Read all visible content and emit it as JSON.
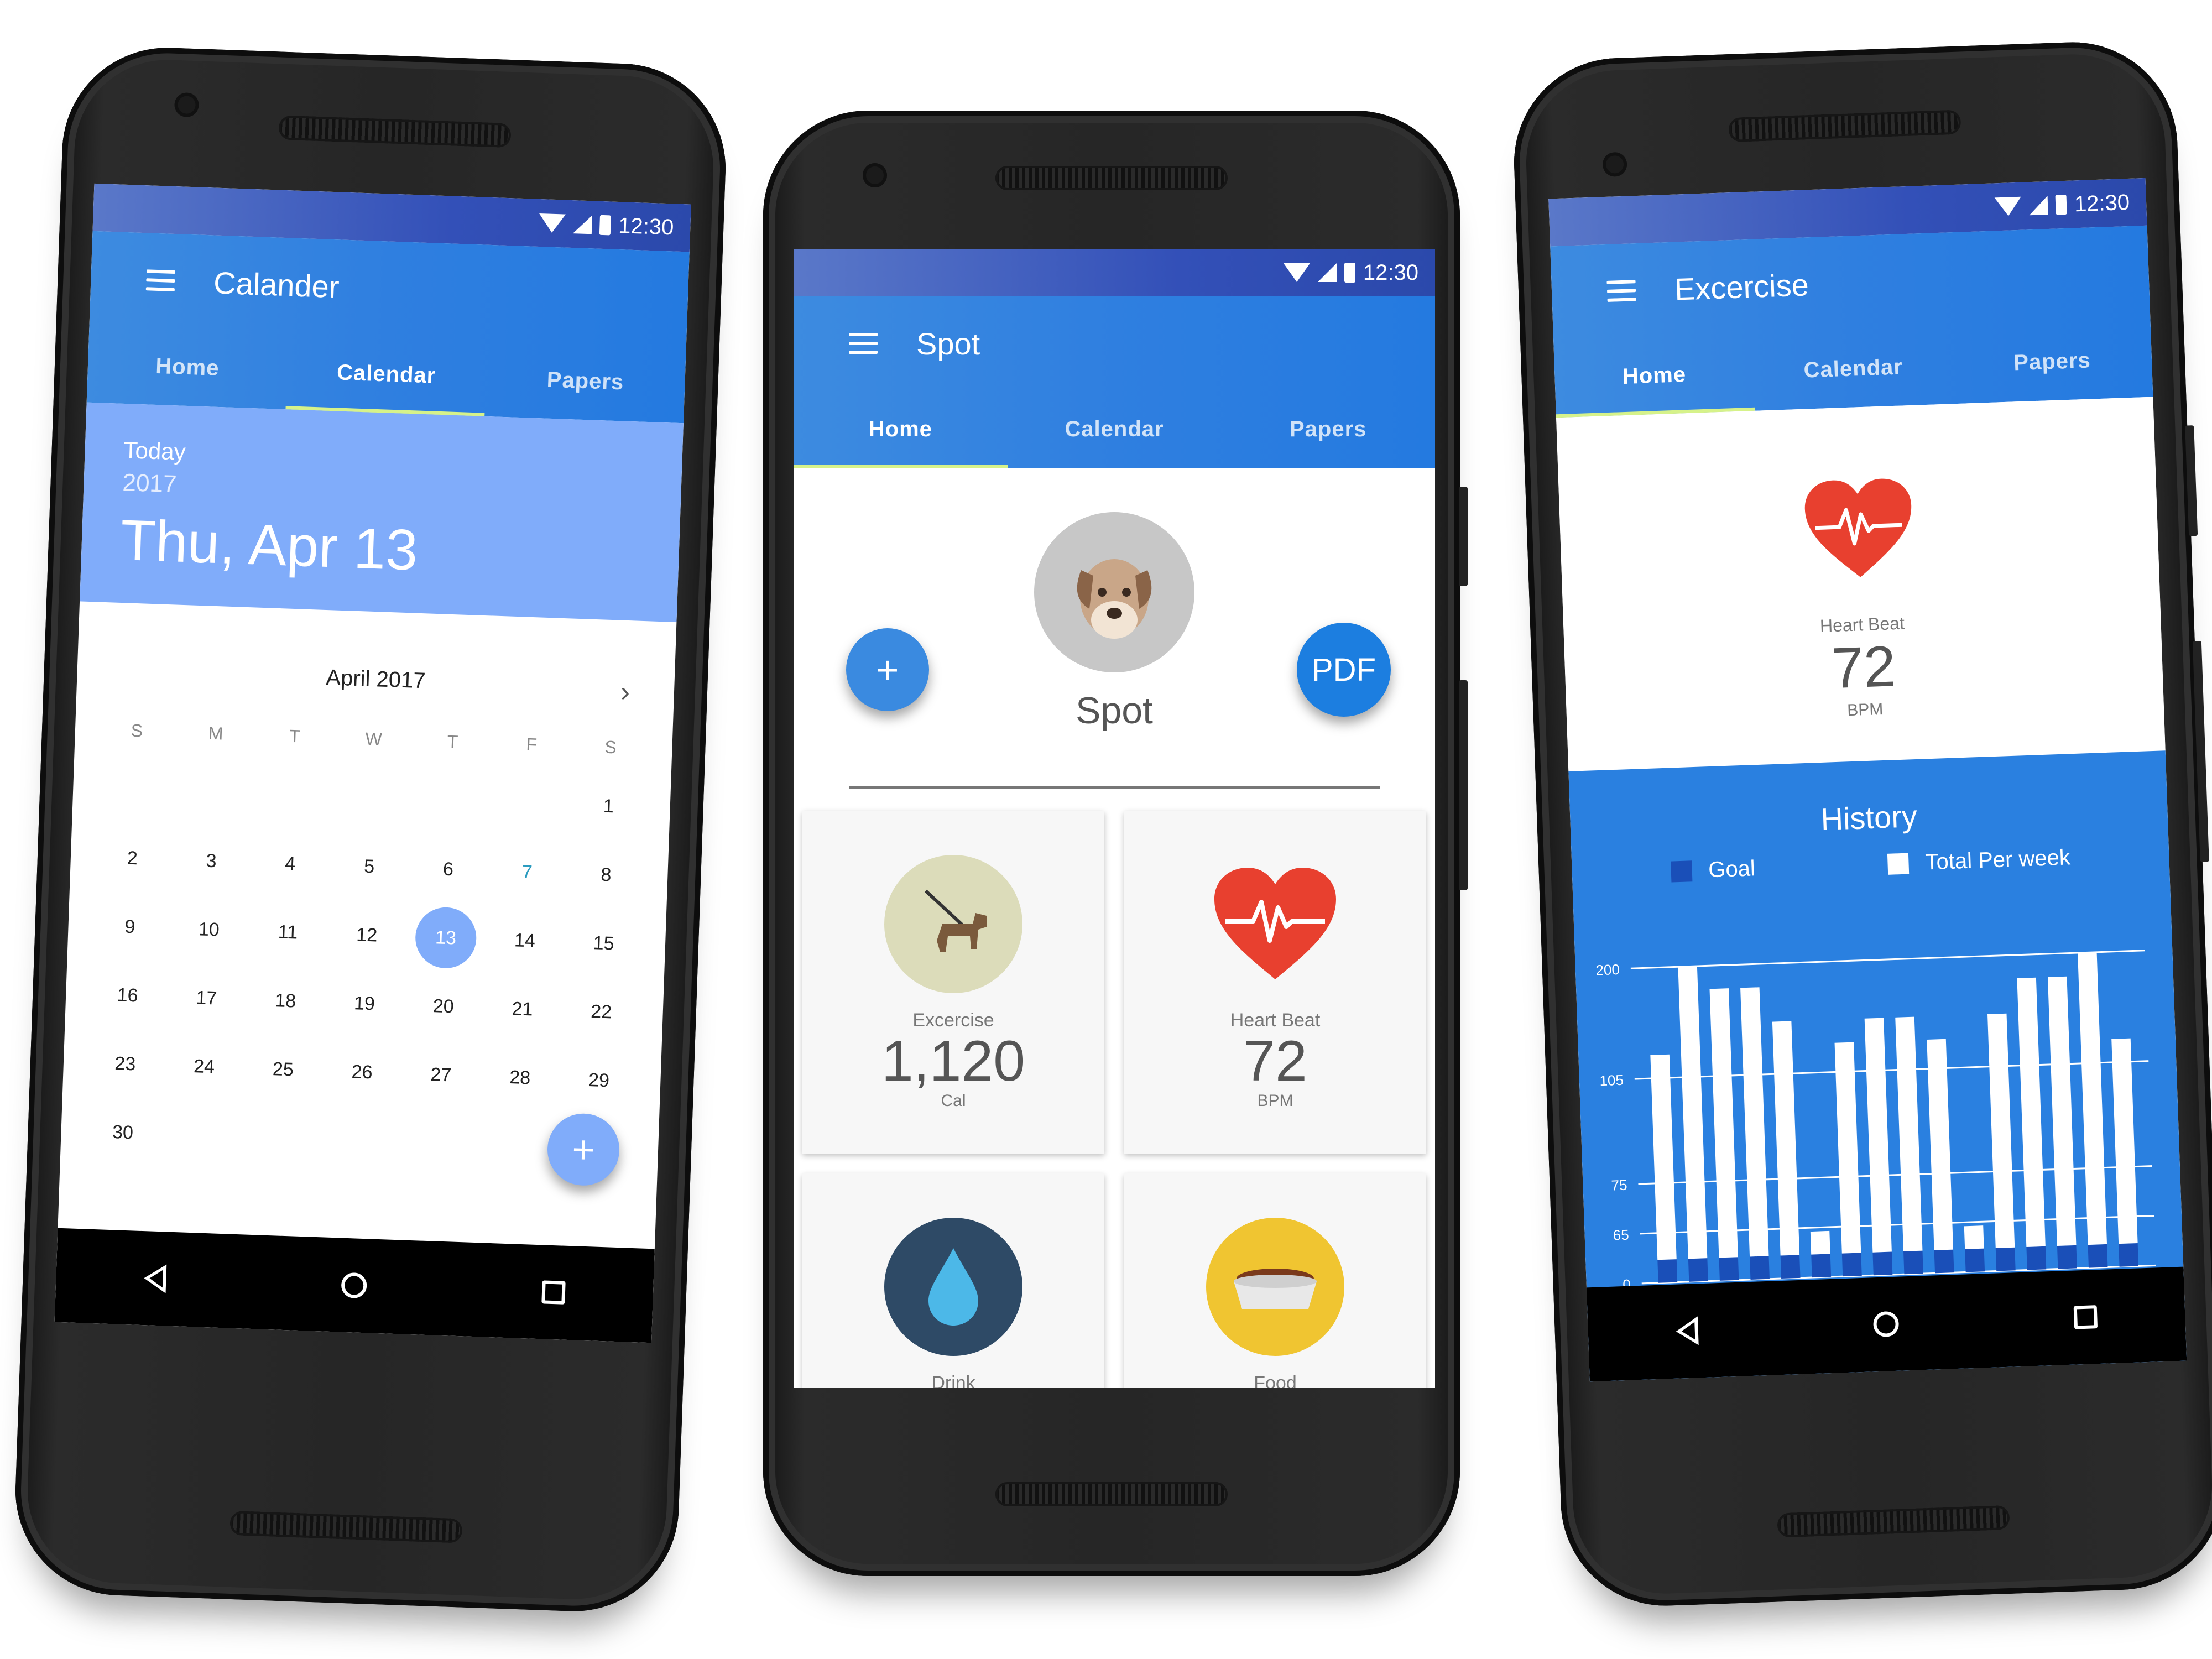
{
  "status": {
    "time": "12:30"
  },
  "colors": {
    "primary": "#2f7fe0",
    "accent": "#d6f28a",
    "calendar_header": "#80acfa",
    "heart": "#e8402f",
    "chart_bg": "#2a80e0",
    "goal": "#1a4fb8"
  },
  "calendar_app": {
    "title": "Calander",
    "tabs": [
      "Home",
      "Calendar",
      "Papers"
    ],
    "active_tab": "Calendar",
    "today_label": "Today",
    "year": "2017",
    "date": "Thu, Apr 13",
    "month": "April 2017",
    "weekdays": [
      "S",
      "M",
      "T",
      "W",
      "T",
      "F",
      "S"
    ],
    "days": [
      [
        "",
        "",
        "",
        "",
        "",
        "",
        "1"
      ],
      [
        "2",
        "3",
        "4",
        "5",
        "6",
        "7",
        "8"
      ],
      [
        "9",
        "10",
        "11",
        "12",
        "13",
        "14",
        "15"
      ],
      [
        "16",
        "17",
        "18",
        "19",
        "20",
        "21",
        "22"
      ],
      [
        "23",
        "24",
        "25",
        "26",
        "27",
        "28",
        "29"
      ],
      [
        "30",
        "",
        "",
        "",
        "",
        "",
        ""
      ]
    ],
    "selected_day": "13",
    "fab": "+"
  },
  "pet_app": {
    "title": "Spot",
    "tabs": [
      "Home",
      "Calendar",
      "Papers"
    ],
    "active_tab": "Home",
    "pet_name": "Spot",
    "add_button": "+",
    "pdf_button": "PDF",
    "cards": [
      {
        "label": "Excercise",
        "value": "1,120",
        "unit": "Cal",
        "icon": "dog-walk-icon"
      },
      {
        "label": "Heart Beat",
        "value": "72",
        "unit": "BPM",
        "icon": "heart-icon"
      },
      {
        "label": "Drink",
        "value": "",
        "unit": "",
        "icon": "water-drop-icon"
      },
      {
        "label": "Food",
        "value": "",
        "unit": "",
        "icon": "food-bowl-icon"
      }
    ]
  },
  "exercise_app": {
    "title": "Excercise",
    "tabs": [
      "Home",
      "Calendar",
      "Papers"
    ],
    "active_tab": "Home",
    "heart_label": "Heart Beat",
    "heart_value": "72",
    "heart_unit": "BPM",
    "history_title": "History",
    "legend": [
      "Goal",
      "Total Per week"
    ]
  },
  "chart_data": {
    "type": "bar",
    "title": "History",
    "series": [
      {
        "name": "Goal",
        "values": [
          30,
          30,
          30,
          30,
          30,
          30,
          30,
          30,
          30,
          30,
          30,
          30,
          30,
          30,
          30,
          30
        ]
      },
      {
        "name": "Total Per week",
        "values": [
          125,
          200,
          180,
          180,
          150,
          60,
          130,
          150,
          150,
          130,
          60,
          150,
          180,
          180,
          200,
          125
        ]
      }
    ],
    "y_ticks": [
      0,
      65,
      75,
      105,
      200
    ],
    "ylim": [
      0,
      200
    ],
    "legend_position": "top",
    "grid": true
  }
}
